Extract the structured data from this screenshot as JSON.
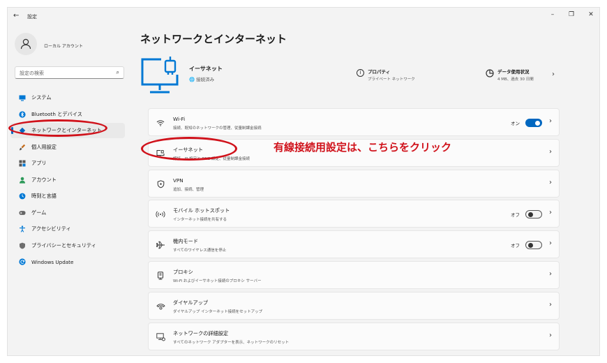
{
  "window": {
    "back_glyph": "←",
    "title": "設定",
    "controls": [
      "–",
      "❐",
      "✕"
    ]
  },
  "sidebar": {
    "account_name": "ローカル アカウント",
    "search_placeholder": "設定の検索",
    "items": [
      {
        "label": "システム",
        "icon": "monitor-icon",
        "color": "#0078d4"
      },
      {
        "label": "Bluetooth とデバイス",
        "icon": "bluetooth-icon",
        "color": "#0078d4"
      },
      {
        "label": "ネットワークとインターネット",
        "icon": "wifi-diamond-icon",
        "color": "#0067c0",
        "selected": true
      },
      {
        "label": "個人用設定",
        "icon": "brush-icon",
        "color": "#c36b1a"
      },
      {
        "label": "アプリ",
        "icon": "apps-icon",
        "color": "#555555"
      },
      {
        "label": "アカウント",
        "icon": "person-icon",
        "color": "#2e9a5a"
      },
      {
        "label": "時刻と言語",
        "icon": "globe-clock-icon",
        "color": "#0078d4"
      },
      {
        "label": "ゲーム",
        "icon": "gamepad-icon",
        "color": "#666666"
      },
      {
        "label": "アクセシビリティ",
        "icon": "accessibility-icon",
        "color": "#0078d4"
      },
      {
        "label": "プライバシーとセキュリティ",
        "icon": "shield-icon",
        "color": "#666666"
      },
      {
        "label": "Windows Update",
        "icon": "update-icon",
        "color": "#0078d4"
      }
    ]
  },
  "main": {
    "title": "ネットワークとインターネット",
    "hero": {
      "name": "イーサネット",
      "status": "接続済み",
      "properties_title": "プロパティ",
      "properties_sub": "プライベート ネットワーク",
      "usage_title": "データ使用状況",
      "usage_sub": "4 MB、過去 30 日間"
    },
    "cards": [
      {
        "title": "Wi-Fi",
        "sub": "接続、既知のネットワークの管理、従量制課金接続",
        "icon": "wifi-icon",
        "toggle": "on",
        "toggle_label": "オン"
      },
      {
        "title": "イーサネット",
        "sub": "認証、IP 設定と DNS 設定、従量制課金接続",
        "icon": "ethernet-icon"
      },
      {
        "title": "VPN",
        "sub": "追加、接続、管理",
        "icon": "vpn-shield-icon"
      },
      {
        "title": "モバイル ホットスポット",
        "sub": "インターネット接続を共有する",
        "icon": "hotspot-icon",
        "toggle": "off",
        "toggle_label": "オフ"
      },
      {
        "title": "機内モード",
        "sub": "すべてのワイヤレス通信を停止",
        "icon": "airplane-icon",
        "toggle": "off",
        "toggle_label": "オフ"
      },
      {
        "title": "プロキシ",
        "sub": "Wi-Fi およびイーサネット接続のプロキシ サーバー",
        "icon": "proxy-icon"
      },
      {
        "title": "ダイヤルアップ",
        "sub": "ダイヤルアップ インターネット接続をセットアップ",
        "icon": "dialup-icon"
      },
      {
        "title": "ネットワークの詳細設定",
        "sub": "すべてのネットワーク アダプターを表示、ネットワークのリセット",
        "icon": "advanced-network-icon"
      }
    ]
  },
  "annotation": {
    "text": "有線接続用設定は、こちらをクリック",
    "color": "#d0121b"
  },
  "colors": {
    "accent": "#0067c0",
    "hero_icon": "#0078d4"
  }
}
